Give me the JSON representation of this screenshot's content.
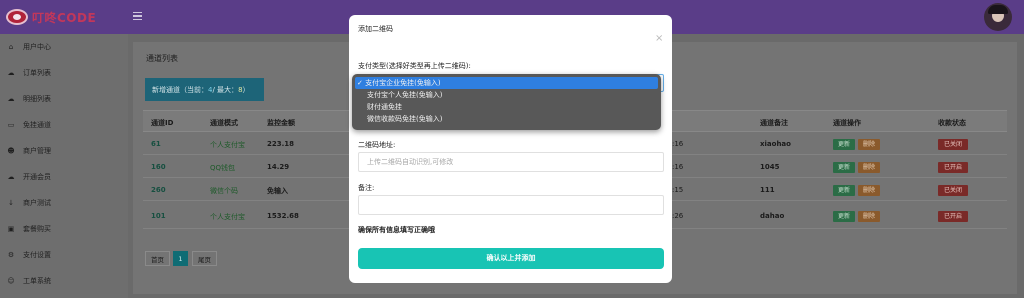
{
  "header": {
    "logo_text": "叮咚CODE"
  },
  "sidebar": {
    "items": [
      {
        "label": "用户中心",
        "icon": "home-icon"
      },
      {
        "label": "订单列表",
        "icon": "cloud-icon"
      },
      {
        "label": "明细列表",
        "icon": "cloud-icon"
      },
      {
        "label": "免挂通道",
        "icon": "monitor-icon"
      },
      {
        "label": "商户管理",
        "icon": "users-icon"
      },
      {
        "label": "开通会员",
        "icon": "cloud-icon"
      },
      {
        "label": "商户测试",
        "icon": "download-icon"
      },
      {
        "label": "套餐购买",
        "icon": "gift-icon"
      },
      {
        "label": "支付设置",
        "icon": "gear-icon"
      },
      {
        "label": "工单系统",
        "icon": "user-icon"
      }
    ]
  },
  "main": {
    "card_title": "通道列表",
    "new_channel": {
      "prefix": "新增通道（当前：",
      "current": "4",
      "sep": " / 最大：",
      "max": "8",
      "suffix": "）"
    },
    "table": {
      "headers": [
        "通道ID",
        "通道模式",
        "监控金额",
        "通道备注",
        "通道操作",
        "收款状态"
      ],
      "rows": [
        {
          "id": "61",
          "mode": "个人支付宝",
          "amount": "223.18",
          "time": ":16",
          "note": "xiaohao",
          "edit": "更新",
          "del": "删除",
          "status": "已关闭"
        },
        {
          "id": "160",
          "mode": "QQ钱包",
          "amount": "14.29",
          "time": ":16",
          "note": "1045",
          "edit": "更新",
          "del": "删除",
          "status": "已开启"
        },
        {
          "id": "260",
          "mode": "微信个码",
          "amount": "免输入",
          "time": ":15",
          "note": "111",
          "edit": "更新",
          "del": "删除",
          "status": "已关闭"
        },
        {
          "id": "101",
          "mode": "个人支付宝",
          "amount": "1532.68",
          "time": ":26",
          "note": "dahao",
          "edit": "更新",
          "del": "删除",
          "status": "已开启"
        }
      ]
    },
    "pager": {
      "first": "首页",
      "current": "1",
      "last": "尾页"
    }
  },
  "modal": {
    "title": "添加二维码",
    "close": "×",
    "pay_type_label": "支付类型(选择好类型再上传二维码):",
    "pay_type_options": [
      "支付宝企业免挂(免输入)",
      "支付宝个人免挂(免输入)",
      "财付通免挂",
      "微信收款码免挂(免输入)"
    ],
    "pay_type_selected_index": 0,
    "check_mark": "✓",
    "qr_label": "二维码地址:",
    "qr_placeholder": "上传二维码自动识别,可修改",
    "note_label": "备注:",
    "note_placeholder": "",
    "hint": "确保所有信息填写正确哦",
    "submit": "确认以上并添加"
  },
  "colors": {
    "topbar": "#5a3d88",
    "submit": "#18c4b4",
    "dropdown_selected": "#2f7fe0",
    "select_border": "#66afe9"
  }
}
